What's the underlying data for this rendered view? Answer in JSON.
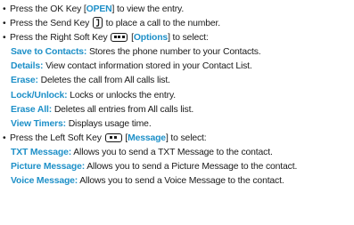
{
  "top_cut_text": "...",
  "lines": {
    "l1": {
      "a": "Press the OK Key [",
      "key": "OPEN",
      "b": "] to view the entry."
    },
    "l2": {
      "a": "Press the Send Key",
      "b": "to place a call to the number."
    },
    "l3": {
      "a": "Press the Right Soft Key",
      "b": "[",
      "key": "Options",
      "c": "] to select:"
    },
    "l4": {
      "term": "Save to Contacts:",
      "desc": "Stores the phone number to your Contacts."
    },
    "l5": {
      "term": "Details:",
      "desc": "View contact information stored in your Contact List."
    },
    "l6": {
      "term": "Erase:",
      "desc": "Deletes the call from All calls list."
    },
    "l7": {
      "term": "Lock/Unlock:",
      "desc": "Locks or unlocks the entry."
    },
    "l8": {
      "term": "Erase All:",
      "desc": "Deletes all entries from All calls list."
    },
    "l9": {
      "term": "View Timers:",
      "desc": "Displays usage time."
    },
    "l10": {
      "a": "Press the Left Soft Key",
      "b": "[",
      "key": "Message",
      "c": "] to select:"
    },
    "l11": {
      "term": "TXT Message:",
      "desc": "Allows you to send a TXT Message to the contact."
    },
    "l12": {
      "term": "Picture Message:",
      "desc": "Allows you to send a Picture Message to the contact."
    },
    "l13": {
      "term": "Voice Message:",
      "desc": "Allows you to send a Voice Message to the contact."
    }
  },
  "bullet_char": "•",
  "icons": {
    "send_key": "send-key-icon",
    "right_soft_key": "right-soft-key-icon",
    "left_soft_key": "left-soft-key-icon"
  },
  "colors": {
    "accent": "#1e90c8",
    "text": "#1a1a1a"
  }
}
